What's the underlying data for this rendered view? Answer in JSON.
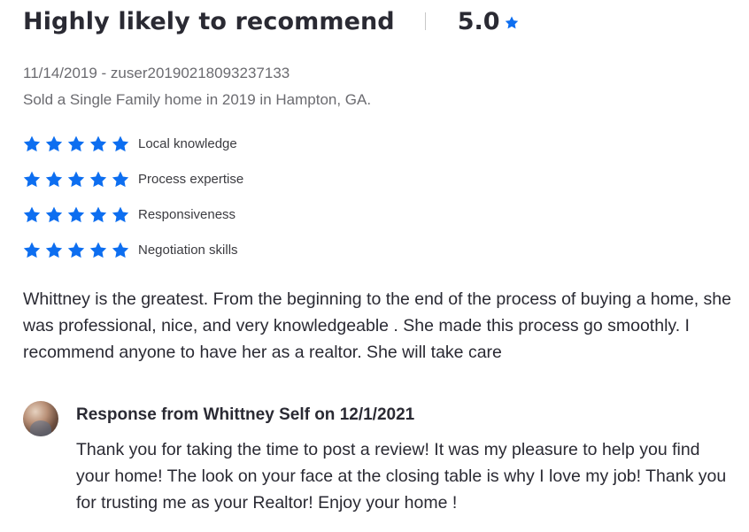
{
  "review": {
    "title": "Highly likely to recommend",
    "overall_score": "5.0",
    "date_user": "11/14/2019 - zuser20190218093237133",
    "transaction": "Sold a Single Family home in 2019 in Hampton, GA.",
    "star_color": "#0d6ef0",
    "ratings": [
      {
        "label": "Local knowledge",
        "stars": 5,
        "max": 5
      },
      {
        "label": "Process expertise",
        "stars": 5,
        "max": 5
      },
      {
        "label": "Responsiveness",
        "stars": 5,
        "max": 5
      },
      {
        "label": "Negotiation skills",
        "stars": 5,
        "max": 5
      }
    ],
    "body": "Whittney is the greatest. From the beginning to the end of the process of buying a home, she was professional, nice, and very knowledgeable . She made this process go smoothly. I recommend anyone to have her as a realtor. She will take care"
  },
  "response": {
    "title": "Response from Whittney Self on 12/1/2021",
    "body": "Thank you for taking the time to post a review! It was my pleasure to help you find your home! The look on your face at the closing table is why I love my job! Thank you for trusting me as your Realtor! Enjoy your home !"
  }
}
